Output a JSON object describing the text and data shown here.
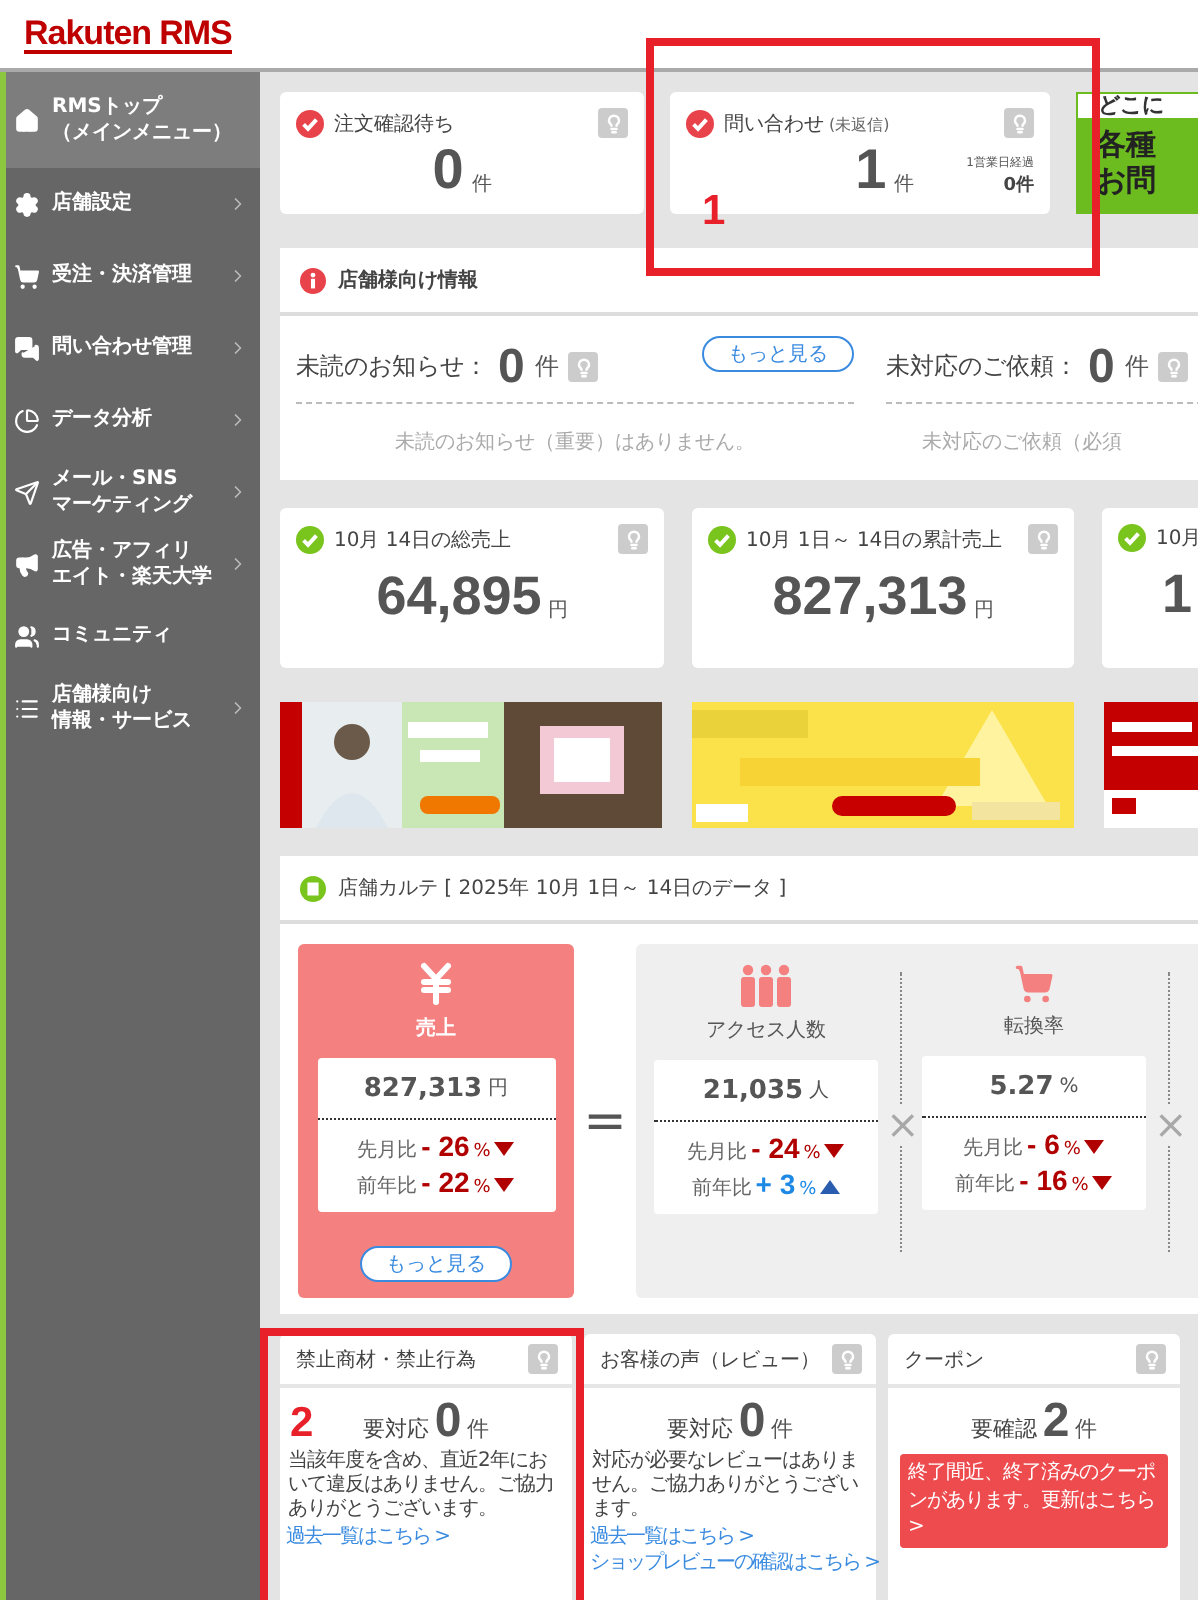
{
  "header": {
    "logo_brand": "Rakuten",
    "logo_product": "RMS"
  },
  "sidebar": {
    "items": [
      {
        "kind": "home",
        "lines": [
          "RMSトップ",
          "（メインメニュー）"
        ],
        "selected": true,
        "submenu": false
      },
      {
        "kind": "gear",
        "lines": [
          "店舗設定"
        ],
        "selected": false,
        "submenu": true
      },
      {
        "kind": "cart",
        "lines": [
          "受注・決済管理"
        ],
        "selected": false,
        "submenu": true
      },
      {
        "kind": "chat",
        "lines": [
          "問い合わせ管理"
        ],
        "selected": false,
        "submenu": true
      },
      {
        "kind": "pie",
        "lines": [
          "データ分析"
        ],
        "selected": false,
        "submenu": true
      },
      {
        "kind": "send",
        "lines": [
          "メール・SNS",
          "マーケティング"
        ],
        "selected": false,
        "submenu": true
      },
      {
        "kind": "megaphone",
        "lines": [
          "広告・アフィリ",
          "エイト・楽天大学"
        ],
        "selected": false,
        "submenu": true
      },
      {
        "kind": "users",
        "lines": [
          "コミュニティ"
        ],
        "selected": false,
        "submenu": false
      },
      {
        "kind": "list",
        "lines": [
          "店舗様向け",
          "情報・サービス"
        ],
        "selected": false,
        "submenu": true
      }
    ]
  },
  "summary_cards": [
    {
      "title": "注文確認待ち",
      "value": "0",
      "unit": "件"
    },
    {
      "title": "問い合わせ",
      "title_note": "(未返信)",
      "value": "1",
      "unit": "件",
      "sub_label": "1営業日経過",
      "sub_value": "0件"
    }
  ],
  "promo": {
    "heading": "どこに",
    "lines": [
      "各種",
      "お問"
    ]
  },
  "notice_panel": {
    "title": "店舗様向け情報",
    "blocks": [
      {
        "label": "未読のお知らせ：",
        "value": "0",
        "unit": "件",
        "button": "もっと見る",
        "message": "未読のお知らせ（重要）はありません。"
      },
      {
        "label": "未対応のご依頼：",
        "value": "0",
        "unit": "件",
        "message": "未対応のご依頼（必須"
      }
    ]
  },
  "sales_cards": [
    {
      "title": "10月 14日の総売上",
      "value": "64,895",
      "unit": "円"
    },
    {
      "title": "10月 1日～ 14日の累計売上",
      "value": "827,313",
      "unit": "円"
    },
    {
      "title": "10月",
      "value": "1"
    }
  ],
  "karte": {
    "title": "店舗カルテ [ 2025年 10月 1日～ 14日のデータ ]",
    "main": {
      "label": "売上",
      "value": "827,313",
      "unit": "円",
      "button": "もっと見る",
      "comparisons": [
        {
          "label": "先月比",
          "sign": "-",
          "value": "26",
          "unit": "%",
          "increase": false
        },
        {
          "label": "前年比",
          "sign": "-",
          "value": "22",
          "unit": "%",
          "increase": false
        }
      ]
    },
    "equals": "=",
    "factors": [
      {
        "kind": "people",
        "label": "アクセス人数",
        "value": "21,035",
        "unit": "人",
        "operator": "×",
        "comparisons": [
          {
            "label": "先月比",
            "sign": "-",
            "value": "24",
            "unit": "%",
            "increase": false
          },
          {
            "label": "前年比",
            "sign": "+",
            "value": "3",
            "unit": "%",
            "increase": true
          }
        ]
      },
      {
        "kind": "cart",
        "label": "転換率",
        "value": "5.27",
        "unit": "%",
        "operator": "×",
        "comparisons": [
          {
            "label": "先月比",
            "sign": "-",
            "value": "6",
            "unit": "%",
            "increase": false
          },
          {
            "label": "前年比",
            "sign": "-",
            "value": "16",
            "unit": "%",
            "increase": false
          }
        ]
      }
    ]
  },
  "status_cards": [
    {
      "title": "禁止商材・禁止行為",
      "status": "要対応",
      "value": "0",
      "unit": "件",
      "message": "当該年度を含め、直近2年において違反はありません。ご協力ありがとうございます。",
      "links": [
        "過去一覧はこちら >"
      ]
    },
    {
      "title": "お客様の声（レビュー）",
      "status": "要対応",
      "value": "0",
      "unit": "件",
      "message": "対応が必要なレビューはありません。ご協力ありがとうございます。",
      "links": [
        "過去一覧はこちら >",
        "ショップレビューの確認はこちら >"
      ]
    },
    {
      "title": "クーポン",
      "status": "要確認",
      "value": "2",
      "unit": "件",
      "alert": "終了間近、終了済みのクーポンがあります。更新はこちら >"
    }
  ],
  "annotations": [
    {
      "label": "1"
    },
    {
      "label": "2"
    }
  ]
}
